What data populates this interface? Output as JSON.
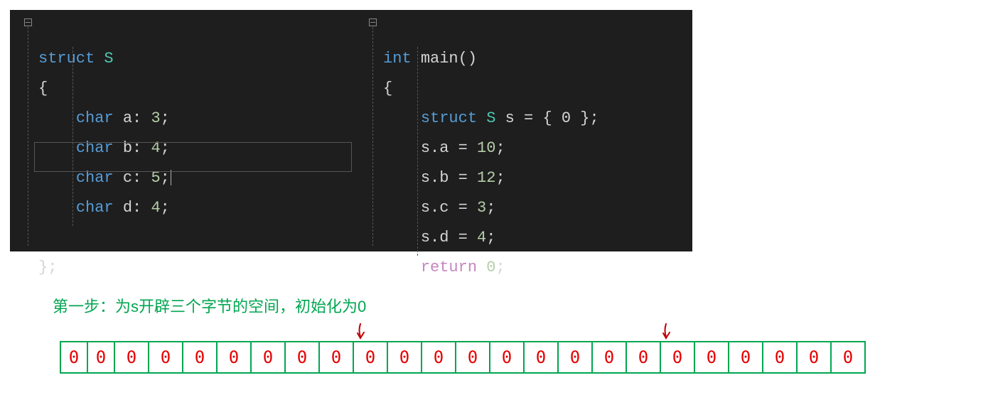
{
  "code_left": {
    "keyword_struct": "struct",
    "type_name": "S",
    "brace_open": "{",
    "fields": [
      {
        "type": "char",
        "name": "a",
        "bits": "3"
      },
      {
        "type": "char",
        "name": "b",
        "bits": "4"
      },
      {
        "type": "char",
        "name": "c",
        "bits": "5"
      },
      {
        "type": "char",
        "name": "d",
        "bits": "4"
      }
    ],
    "brace_close": "};"
  },
  "code_right": {
    "ret_type": "int",
    "fn_name": "main",
    "parens": "()",
    "brace_open": "{",
    "decl": {
      "kw": "struct",
      "type": "S",
      "var": "s",
      "eq": "=",
      "init": "{ 0 };"
    },
    "assigns": [
      {
        "lhs_obj": "s",
        "lhs_field": "a",
        "rhs": "10"
      },
      {
        "lhs_obj": "s",
        "lhs_field": "b",
        "rhs": "12"
      },
      {
        "lhs_obj": "s",
        "lhs_field": "c",
        "rhs": "3"
      },
      {
        "lhs_obj": "s",
        "lhs_field": "d",
        "rhs": "4"
      }
    ],
    "return_kw": "return",
    "return_val": "0"
  },
  "step_caption": "第一步：为s开辟三个字节的空间，初始化为0",
  "bits": [
    "0",
    "0",
    "0",
    "0",
    "0",
    "0",
    "0",
    "0",
    "0",
    "0",
    "0",
    "0",
    "0",
    "0",
    "0",
    "0",
    "0",
    "0",
    "0",
    "0",
    "0",
    "0",
    "0",
    "0"
  ]
}
